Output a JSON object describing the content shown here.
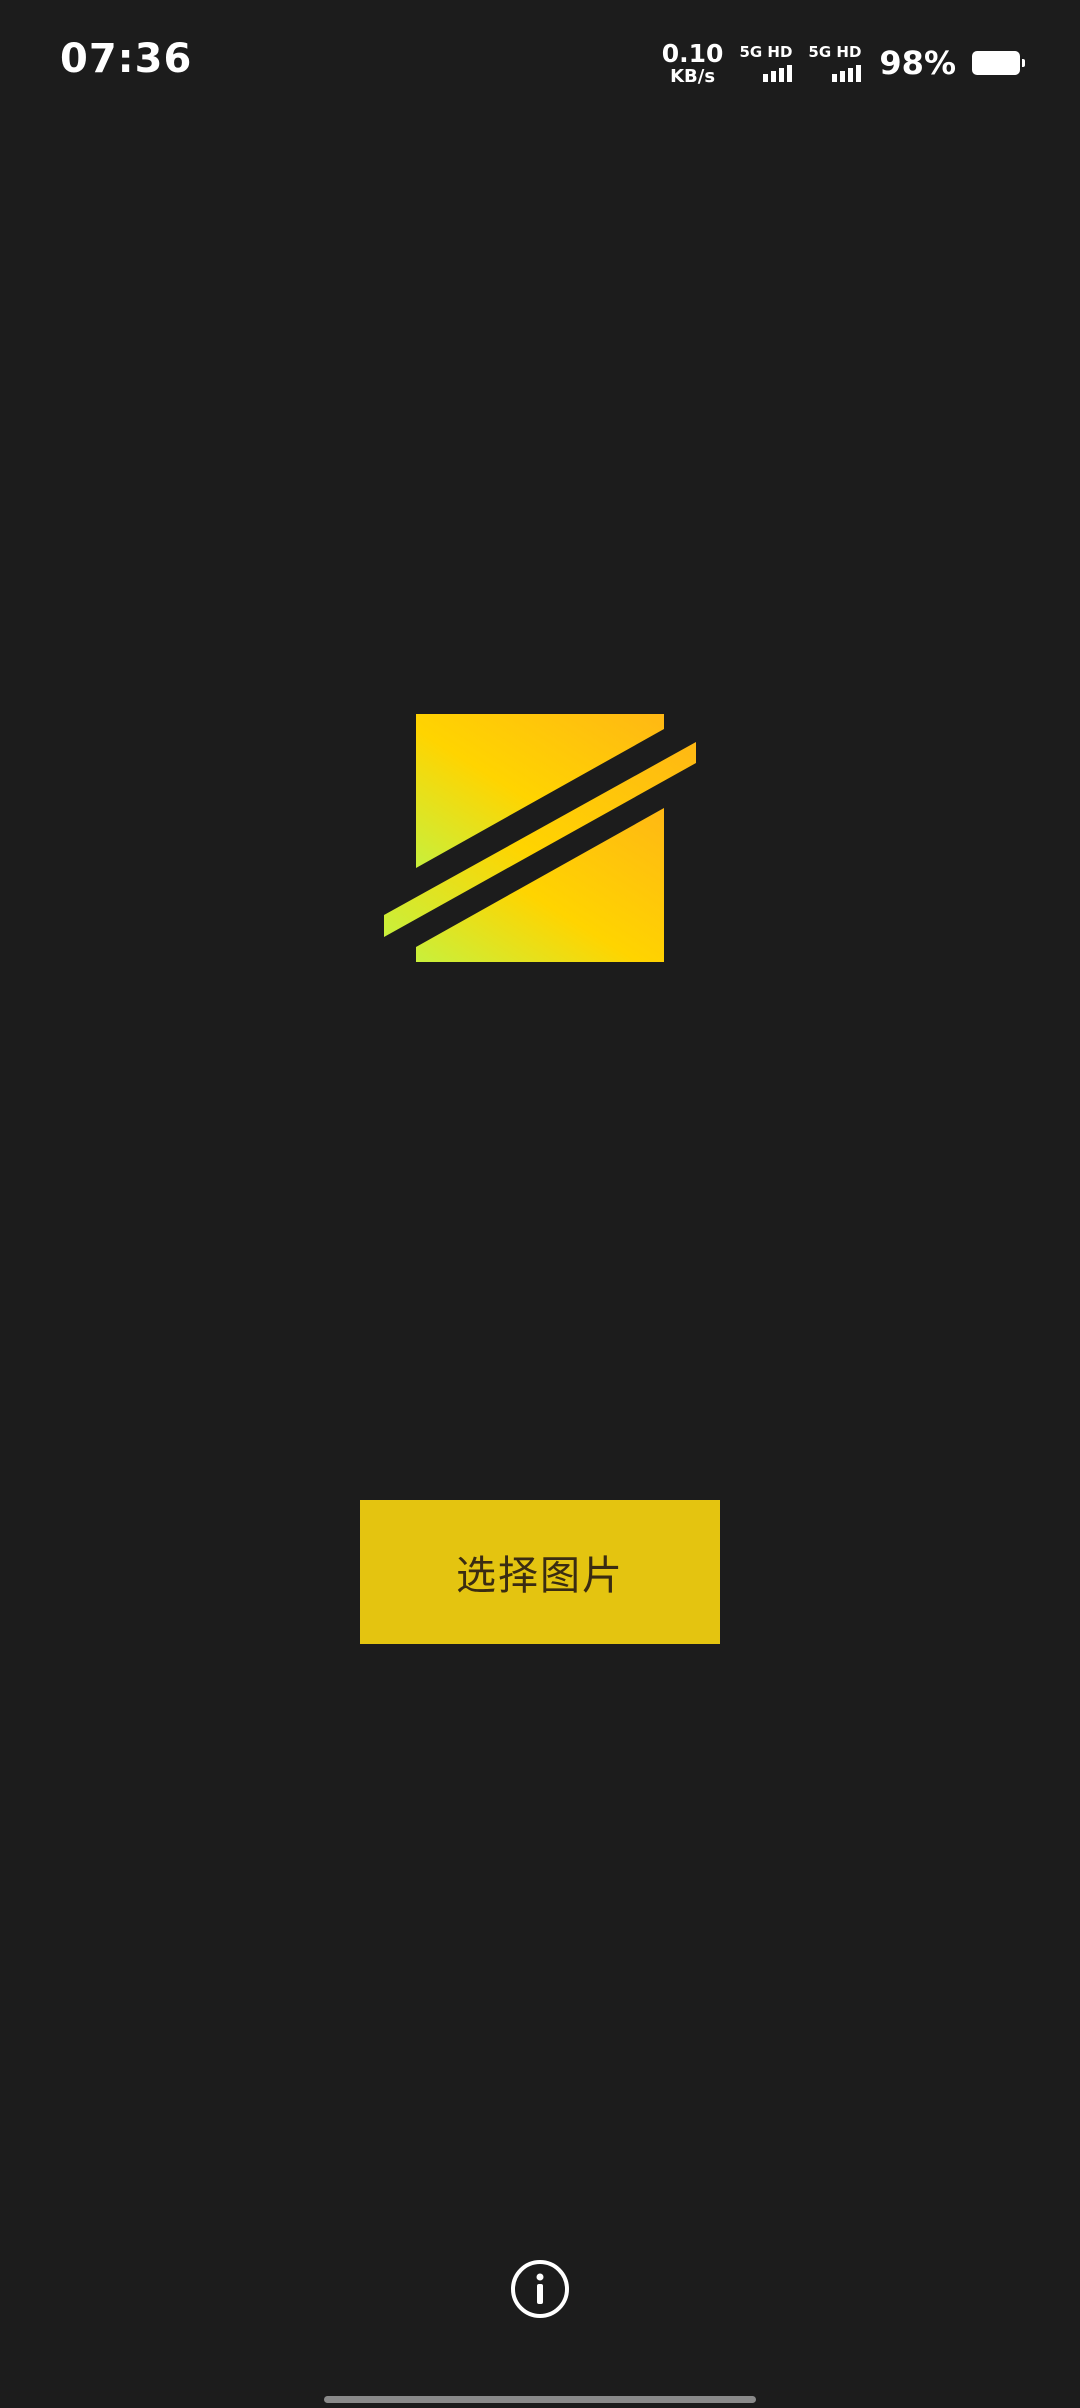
{
  "status_bar": {
    "time": "07:36",
    "net_speed_value": "0.10",
    "net_speed_unit": "KB/s",
    "sim1_label": "5G HD",
    "sim2_label": "5G HD",
    "battery_percent": "98%"
  },
  "logo": {
    "icon": "app-logo-icon",
    "gradient_start": "#c8f03c",
    "gradient_end": "#ffc400"
  },
  "main": {
    "select_button_label": "选择图片",
    "button_color": "#e4c410"
  },
  "footer": {
    "info_icon": "info-icon"
  },
  "colors": {
    "background": "#1c1c1c"
  }
}
